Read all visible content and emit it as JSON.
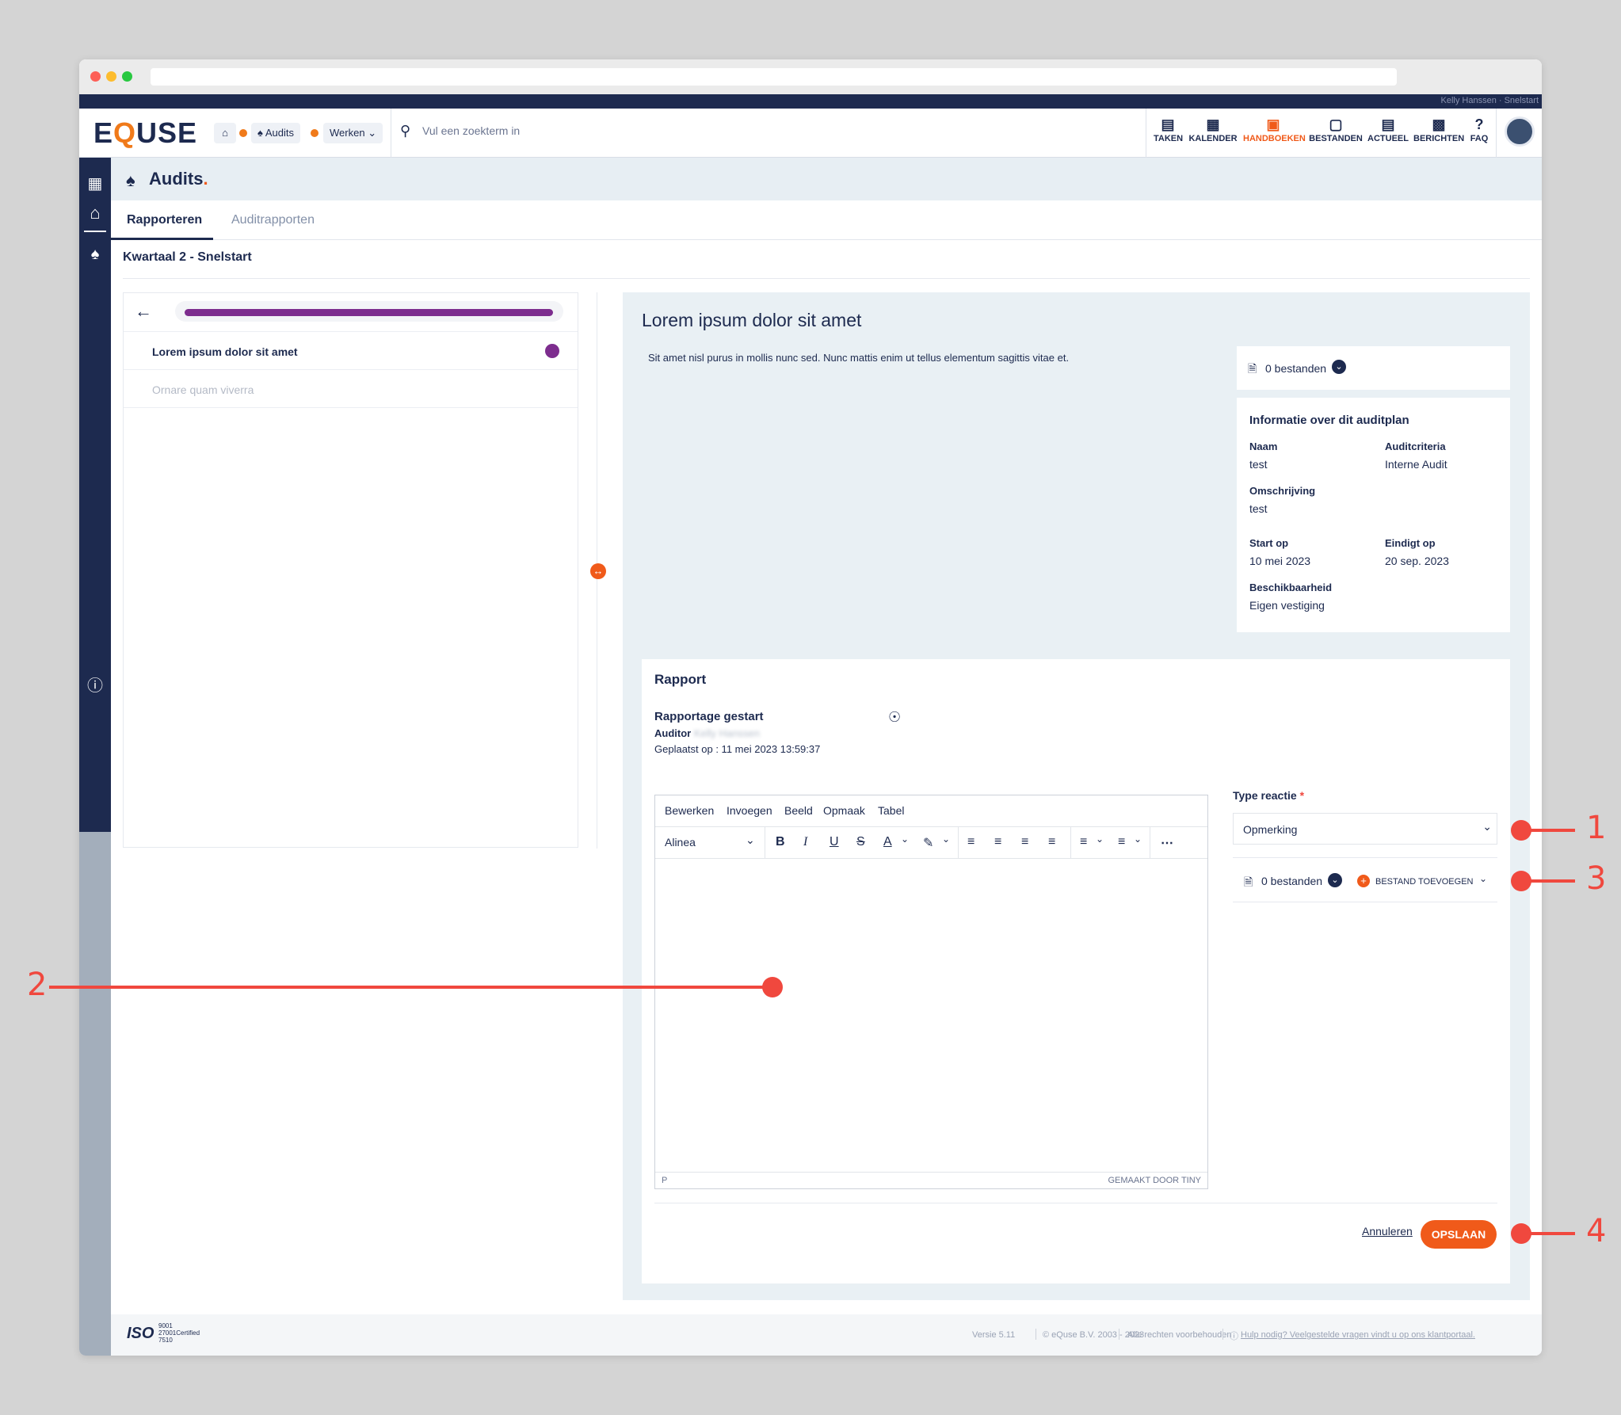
{
  "header": {
    "logo": "EQUSE",
    "user_strip": "Kelly Hanssen · Snelstart",
    "breadcrumb": [
      "Audits",
      "Werken"
    ],
    "search_placeholder": "Vul een zoekterm in",
    "nav": [
      "TAKEN",
      "KALENDER",
      "HANDBOEKEN",
      "BESTANDEN",
      "ACTUEEL",
      "BERICHTEN",
      "FAQ"
    ],
    "nav_active": "HANDBOEKEN"
  },
  "page": {
    "title": "Audits",
    "tabs": [
      "Rapporteren",
      "Auditrapporten"
    ],
    "subtitle": "Kwartaal 2 - Snelstart"
  },
  "left_list": [
    "Lorem ipsum dolor sit amet",
    "Ornare quam viverra"
  ],
  "main": {
    "heading": "Lorem ipsum dolor sit amet",
    "description": "Sit amet nisl purus in mollis nunc sed. Nunc mattis enim ut tellus elementum sagittis vitae et.",
    "files": "0 bestanden"
  },
  "info": {
    "title": "Informatie over dit auditplan",
    "naam_label": "Naam",
    "naam": "test",
    "criteria_label": "Auditcriteria",
    "criteria": "Interne Audit",
    "omschrijving_label": "Omschrijving",
    "omschrijving": "test",
    "start_label": "Start op",
    "start": "10 mei 2023",
    "eind_label": "Eindigt op",
    "eind": "20 sep. 2023",
    "beschikbaar_label": "Beschikbaarheid",
    "beschikbaar": "Eigen vestiging"
  },
  "report": {
    "title": "Rapport",
    "status": "Rapportage gestart",
    "auditor_label": "Auditor",
    "auditor_name": "Kelly Hanssen",
    "placed": "Geplaatst op : 11 mei 2023 13:59:37",
    "menu": [
      "Bewerken",
      "Invoegen",
      "Beeld",
      "Opmaak",
      "Tabel"
    ],
    "block_format": "Alinea",
    "status_path": "P",
    "branding": "GEMAAKT DOOR TINY",
    "type_label": "Type reactie",
    "required_mark": "*",
    "type_value": "Opmerking",
    "files": "0 bestanden",
    "add_file": "BESTAND TOEVOEGEN",
    "cancel": "Annuleren",
    "save": "OPSLAAN"
  },
  "callouts": [
    "1",
    "2",
    "3",
    "4"
  ],
  "footer": {
    "iso": "ISO",
    "iso_numbers": "9001 27001Certified 7510",
    "version": "Versie 5.11",
    "copyright": "© eQuse B.V. 2003 - 2023",
    "rights": "Alle rechten voorbehouden",
    "help": "Hulp nodig? Veelgestelde vragen vindt u op ons klantportaal."
  },
  "colors": {
    "navy": "#1d2a4f",
    "orange": "#f05a1a",
    "purple": "#7d2d8e",
    "callout": "#f0483e"
  }
}
